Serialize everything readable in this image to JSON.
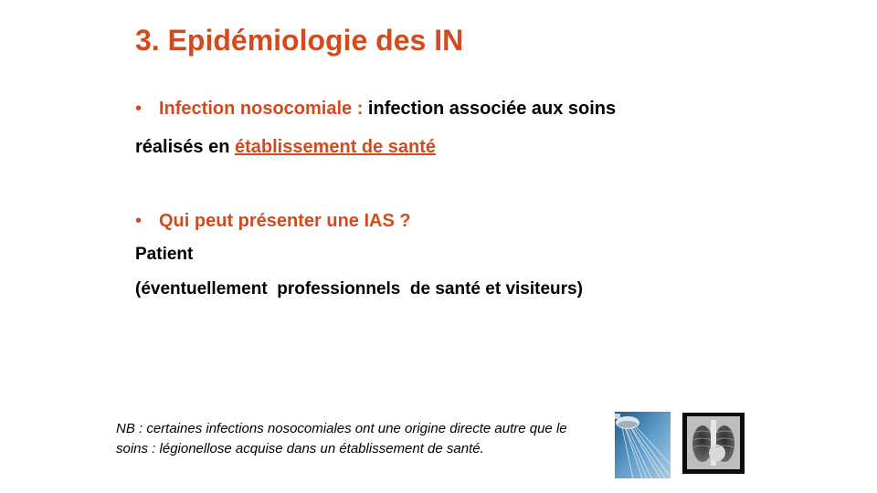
{
  "slide": {
    "title": "3. Epidémiologie des IN",
    "bullet1": {
      "marker": "•",
      "term": "Infection nosocomiale :",
      "definition": " infection associée aux soins",
      "line2_prefix": "réalisés en ",
      "line2_link": "établissement de santé"
    },
    "bullet2": {
      "marker": "•",
      "question": "Qui peut présenter une IAS ?",
      "answer_line1": "Patient",
      "answer_line2": "(éventuellement  professionnels  de santé et visiteurs)"
    },
    "note": "NB : certaines infections nosocomiales ont une origine directe autre que le soins : légionellose acquise dans un établissement de santé.",
    "images": [
      "shower-head-image",
      "chest-xray-image"
    ]
  }
}
